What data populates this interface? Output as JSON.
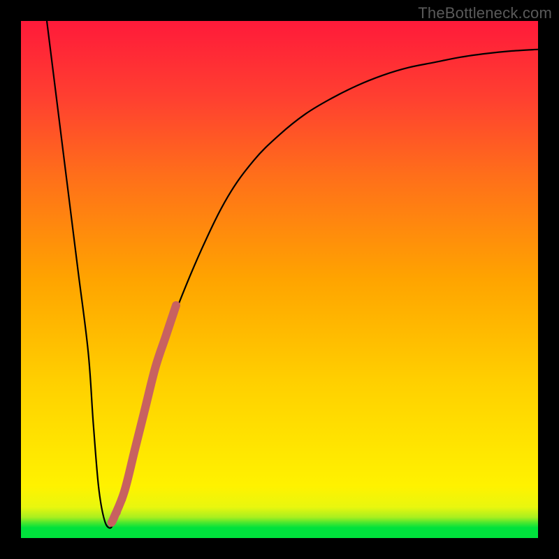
{
  "watermark": "TheBottleneck.com",
  "colors": {
    "frame": "#000000",
    "gradient_top": "#ff1a3a",
    "gradient_bottom": "#00e23c",
    "curve": "#000000",
    "highlight": "#c86160"
  },
  "chart_data": {
    "type": "line",
    "title": "",
    "xlabel": "",
    "ylabel": "",
    "xlim": [
      0,
      100
    ],
    "ylim": [
      0,
      100
    ],
    "series": [
      {
        "name": "bottleneck-curve",
        "x": [
          5,
          7,
          9,
          11,
          13,
          14,
          15,
          16,
          17,
          18,
          20,
          22,
          24,
          26,
          28,
          30,
          35,
          40,
          45,
          50,
          55,
          60,
          65,
          70,
          75,
          80,
          85,
          90,
          95,
          100
        ],
        "values": [
          100,
          84,
          68,
          52,
          36,
          22,
          10,
          4,
          2,
          3,
          8,
          16,
          24,
          32,
          38,
          44,
          56,
          66,
          73,
          78,
          82,
          85,
          87.5,
          89.5,
          91,
          92,
          93,
          93.7,
          94.2,
          94.5
        ]
      }
    ],
    "highlight_segment": {
      "x": [
        17.5,
        18,
        20,
        22,
        24,
        26,
        28,
        30
      ],
      "values": [
        3,
        4,
        9,
        17,
        25,
        33,
        39,
        45
      ]
    },
    "highlight_dots": {
      "x": [
        18.5,
        19.5
      ],
      "values": [
        5,
        7.5
      ]
    }
  }
}
